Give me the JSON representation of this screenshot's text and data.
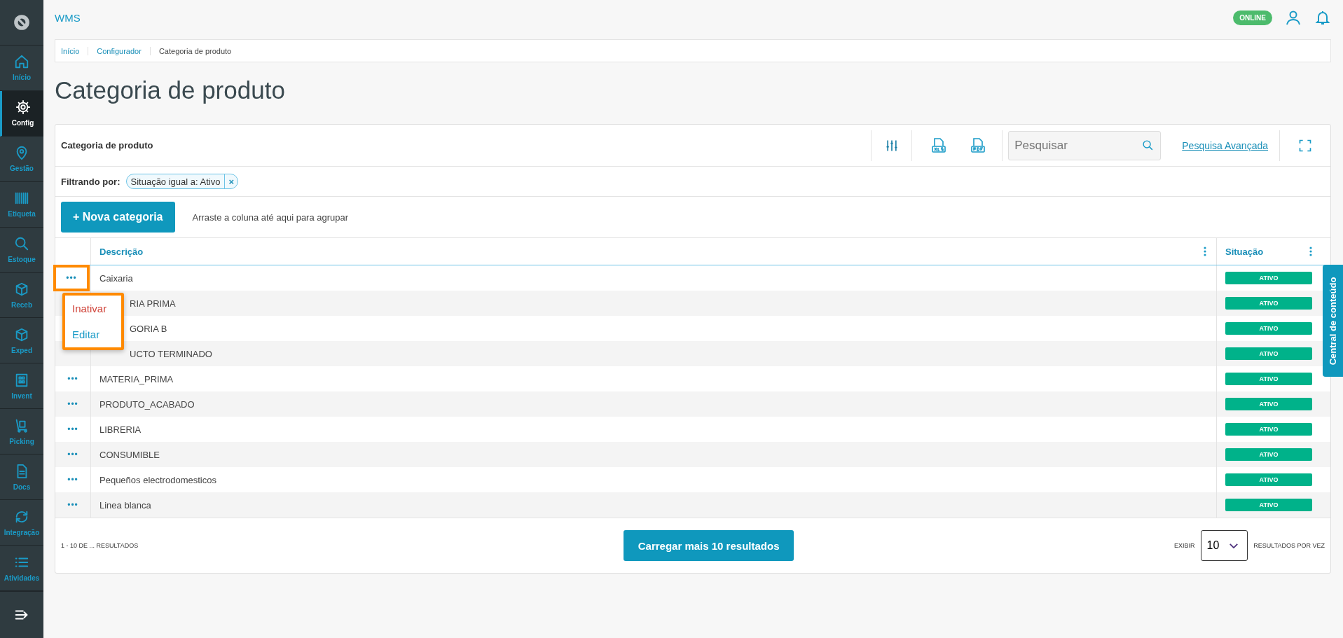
{
  "sidebar": {
    "items": [
      {
        "label": "Início",
        "selected": false
      },
      {
        "label": "Config",
        "selected": true
      },
      {
        "label": "Gestão",
        "selected": false
      },
      {
        "label": "Etiqueta",
        "selected": false
      },
      {
        "label": "Estoque",
        "selected": false
      },
      {
        "label": "Receb",
        "selected": false
      },
      {
        "label": "Exped",
        "selected": false
      },
      {
        "label": "Invent",
        "selected": false
      },
      {
        "label": "Picking",
        "selected": false
      },
      {
        "label": "Docs",
        "selected": false
      },
      {
        "label": "Integração",
        "selected": false
      },
      {
        "label": "Atividades",
        "selected": false
      }
    ]
  },
  "header": {
    "app_name": "WMS",
    "status": "ONLINE"
  },
  "breadcrumb": [
    "Início",
    "Configurador",
    "Categoria de produto"
  ],
  "page_title": "Categoria de produto",
  "card": {
    "title": "Categoria de produto",
    "search": {
      "placeholder": "Pesquisar"
    },
    "advanced_search": "Pesquisa Avançada",
    "filter": {
      "label": "Filtrando por:",
      "chip": "Situação igual a: Ativo",
      "remove": "×"
    },
    "new_button": "+ Nova categoria",
    "group_hint": "Arraste a coluna até aqui para agrupar",
    "columns": [
      "Descrição",
      "Situação"
    ],
    "rows": [
      {
        "description": "Caixaria",
        "status": "ATIVO",
        "actions": "•••",
        "highlighted": true
      },
      {
        "description": "RIA PRIMA",
        "status": "ATIVO"
      },
      {
        "description": "GORIA B",
        "status": "ATIVO"
      },
      {
        "description": "UCTO TERMINADO",
        "status": "ATIVO"
      },
      {
        "description": "MATERIA_PRIMA",
        "status": "ATIVO",
        "actions": "•••",
        "highlighted": false
      },
      {
        "description": "PRODUTO_ACABADO",
        "status": "ATIVO",
        "actions": "•••",
        "highlighted": false
      },
      {
        "description": "LIBRERIA",
        "status": "ATIVO",
        "actions": "•••",
        "highlighted": false
      },
      {
        "description": "CONSUMIBLE",
        "status": "ATIVO",
        "actions": "•••",
        "highlighted": false
      },
      {
        "description": "Pequeños electrodomesticos",
        "status": "ATIVO",
        "actions": "•••",
        "highlighted": false
      },
      {
        "description": "Linea blanca",
        "status": "ATIVO",
        "actions": "•••",
        "highlighted": false
      }
    ],
    "row_menu": [
      {
        "label": "Inativar",
        "kind": "danger"
      },
      {
        "label": "Editar",
        "kind": "normal"
      }
    ],
    "footer": {
      "range": "1 - 10 DE ... RESULTADOS",
      "load_more": "Carregar mais 10 resultados",
      "show_label": "EXIBIR",
      "page_size": "10",
      "per_page_label": "RESULTADOS POR VEZ"
    }
  },
  "side_tab": "Central de conteúdo"
}
